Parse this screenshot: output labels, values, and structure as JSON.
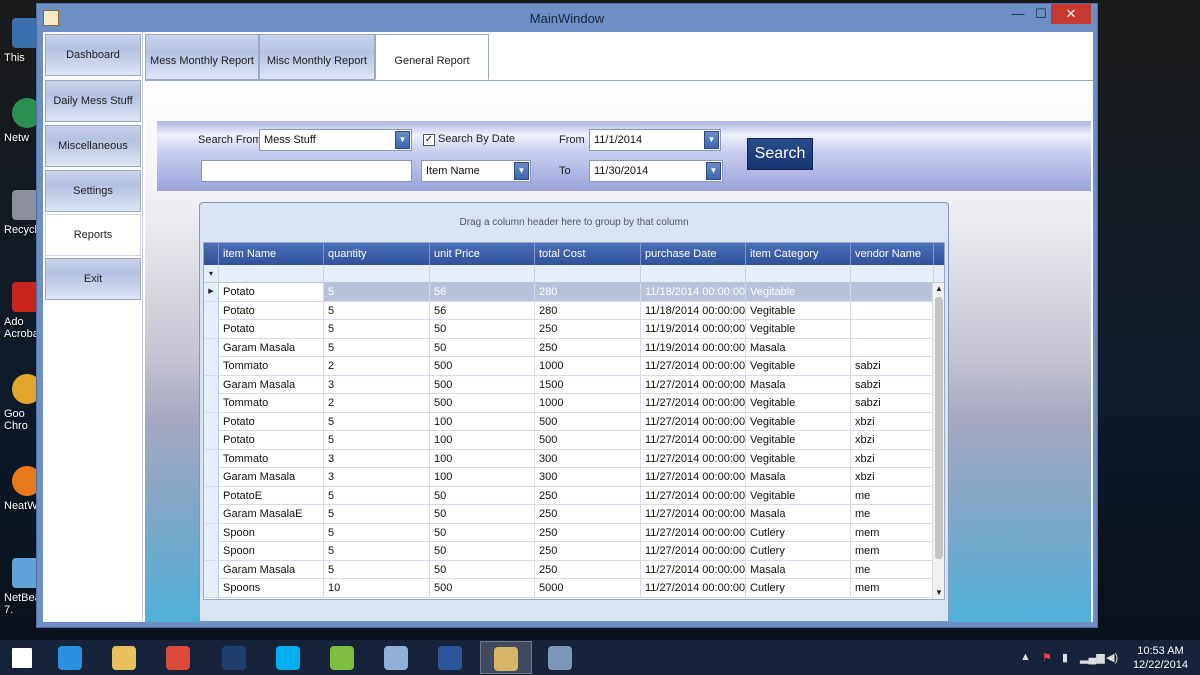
{
  "window": {
    "title": "MainWindow",
    "min_glyph": "—",
    "max_glyph": "☐",
    "close_glyph": "✕"
  },
  "desktop": {
    "icons": [
      {
        "label": "This",
        "color": "#3a6fb0"
      },
      {
        "label": "Netw",
        "color": "#2a8f4f"
      },
      {
        "label": "Recycl",
        "color": "#8a8f99"
      },
      {
        "label": "Ado",
        "label2": "Acroba",
        "color": "#c8261c"
      },
      {
        "label": "Goo",
        "label2": "Chro",
        "color": "#e2a72a"
      },
      {
        "label": "NeatW",
        "color": "#e87a1a"
      },
      {
        "label": "NetBea",
        "label2": "7.",
        "color": "#5ea3d8"
      }
    ]
  },
  "sidebar": {
    "items": [
      {
        "label": "Dashboard"
      },
      {
        "label": "Daily Mess Stuff"
      },
      {
        "label": "Miscellaneous"
      },
      {
        "label": "Settings"
      },
      {
        "label": "Reports",
        "active": true
      },
      {
        "label": "Exit"
      }
    ]
  },
  "tabs": [
    {
      "label": "Mess Monthly Report"
    },
    {
      "label": "Misc Monthly Report"
    },
    {
      "label": "General Report",
      "active": true
    }
  ],
  "filters": {
    "search_from_label": "Search From",
    "search_from_value": "Mess Stuff",
    "search_by_date_label": "Search By Date",
    "search_by_date_checked": "✓",
    "from_label": "From",
    "from_value": "11/1/2014",
    "to_label": "To",
    "to_value": "11/30/2014",
    "search_text_value": "",
    "field_value": "Item Name",
    "search_button": "Search"
  },
  "grid": {
    "group_hint": "Drag a column header here to group by that column",
    "columns": [
      "item Name",
      "quantity",
      "unit Price",
      "total Cost",
      "purchase Date",
      "item Category",
      "vendor Name"
    ],
    "filter_glyph": "▾",
    "row_indicator": "▶",
    "rows": [
      [
        "Potato",
        "5",
        "56",
        "280",
        "11/18/2014 00:00:00",
        "Vegitable",
        ""
      ],
      [
        "Potato",
        "5",
        "56",
        "280",
        "11/18/2014 00:00:00",
        "Vegitable",
        ""
      ],
      [
        "Potato",
        "5",
        "50",
        "250",
        "11/19/2014 00:00:00",
        "Vegitable",
        ""
      ],
      [
        "Garam Masala",
        "5",
        "50",
        "250",
        "11/19/2014 00:00:00",
        "Masala",
        ""
      ],
      [
        "Tommato",
        "2",
        "500",
        "1000",
        "11/27/2014 00:00:00",
        "Vegitable",
        "sabzi"
      ],
      [
        "Garam Masala",
        "3",
        "500",
        "1500",
        "11/27/2014 00:00:00",
        "Masala",
        "sabzi"
      ],
      [
        "Tommato",
        "2",
        "500",
        "1000",
        "11/27/2014 00:00:00",
        "Vegitable",
        "sabzi"
      ],
      [
        "Potato",
        "5",
        "100",
        "500",
        "11/27/2014 00:00:00",
        "Vegitable",
        "xbzi"
      ],
      [
        "Potato",
        "5",
        "100",
        "500",
        "11/27/2014 00:00:00",
        "Vegitable",
        "xbzi"
      ],
      [
        "Tommato",
        "3",
        "100",
        "300",
        "11/27/2014 00:00:00",
        "Vegitable",
        "xbzi"
      ],
      [
        "Garam Masala",
        "3",
        "100",
        "300",
        "11/27/2014 00:00:00",
        "Masala",
        "xbzi"
      ],
      [
        "PotatoE",
        "5",
        "50",
        "250",
        "11/27/2014 00:00:00",
        "Vegitable",
        "me"
      ],
      [
        "Garam MasalaE",
        "5",
        "50",
        "250",
        "11/27/2014 00:00:00",
        "Masala",
        "me"
      ],
      [
        "Spoon",
        "5",
        "50",
        "250",
        "11/27/2014 00:00:00",
        "Cutlery",
        "mem"
      ],
      [
        "Spoon",
        "5",
        "50",
        "250",
        "11/27/2014 00:00:00",
        "Cutlery",
        "mem"
      ],
      [
        "Garam Masala",
        "5",
        "50",
        "250",
        "11/27/2014 00:00:00",
        "Masala",
        "me"
      ],
      [
        "Spoons",
        "10",
        "500",
        "5000",
        "11/27/2014 00:00:00",
        "Cutlery",
        "mem"
      ]
    ],
    "scroll_up_glyph": "▲",
    "scroll_down_glyph": "▼"
  },
  "taskbar": {
    "apps": [
      {
        "name": "start-icon",
        "color": "#ffffff"
      },
      {
        "name": "internet-explorer-icon",
        "color": "#2b8fe0"
      },
      {
        "name": "file-explorer-icon",
        "color": "#e8c15a"
      },
      {
        "name": "chrome-icon",
        "color": "#d94a38"
      },
      {
        "name": "photoshop-icon",
        "color": "#1e3f6e"
      },
      {
        "name": "skype-icon",
        "color": "#00aff0"
      },
      {
        "name": "google-talk-icon",
        "color": "#7fbf3f"
      },
      {
        "name": "virtualbox-icon",
        "color": "#8fb0d8"
      },
      {
        "name": "word-icon",
        "color": "#2b579a"
      },
      {
        "name": "mess-app-icon",
        "color": "#d9b56a",
        "active": true
      },
      {
        "name": "paint-icon",
        "color": "#7d98b8"
      }
    ],
    "time": "10:53 AM",
    "date": "12/22/2014"
  }
}
